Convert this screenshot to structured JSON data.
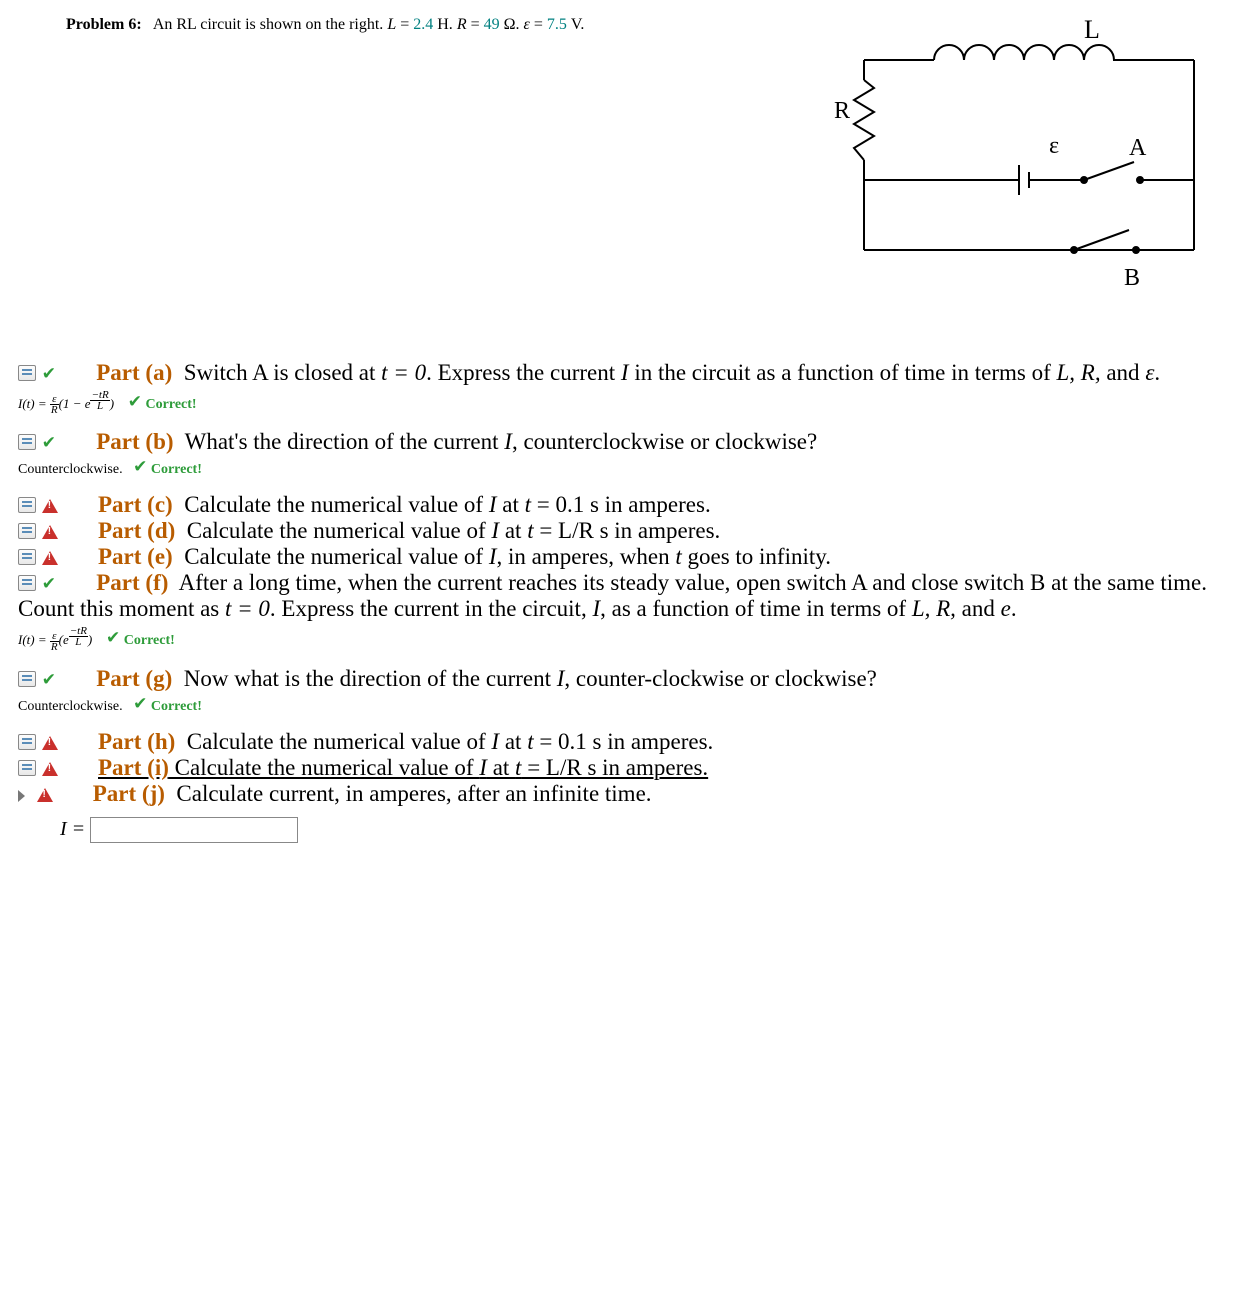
{
  "problem": {
    "label": "Problem 6:",
    "text_pre": "An RL circuit is shown on the right. ",
    "L_sym": "L",
    "L_eq": " = ",
    "L_val": "2.4",
    "L_unit": " H. ",
    "R_sym": "R",
    "R_eq": " = ",
    "R_val": "49",
    "R_unit": " Ω. ",
    "E_sym": "ε",
    "E_eq": " = ",
    "E_val": "7.5",
    "E_unit": " V."
  },
  "circuit": {
    "L": "L",
    "R": "R",
    "eps": "ε",
    "A": "A",
    "B": "B"
  },
  "parts": {
    "a": {
      "label": "Part (a)",
      "text1": "Switch A is closed at ",
      "eq": "t = 0",
      "text2": ". Express the current ",
      "Isym": "I",
      "text3": " in the circuit as a function of time in terms of ",
      "vars": "L, R,",
      "text4": " and ",
      "eps": "ε",
      "period": ".",
      "formula_prefix": "I(t) = ",
      "formula_num": "ε",
      "formula_den": "R",
      "formula_mid": "(1 − e",
      "formula_exp_num": "−tR",
      "formula_exp_den": "L",
      "formula_suffix": ")",
      "correct": "Correct!"
    },
    "b": {
      "label": "Part (b)",
      "text": "What's the direction of the current ",
      "Isym": "I",
      "text2": ", counterclockwise or clockwise?",
      "answer": "Counterclockwise.",
      "correct": "Correct!"
    },
    "c": {
      "label": "Part (c)",
      "text": "Calculate the numerical value of ",
      "I": "I",
      "mid": " at ",
      "t": "t",
      "eq": " = 0.1 s in amperes."
    },
    "d": {
      "label": "Part (d)",
      "text": "Calculate the numerical value of ",
      "I": "I",
      "mid": " at ",
      "t": "t",
      "eq": " = L/R s in amperes."
    },
    "e": {
      "label": "Part (e)",
      "text": "Calculate the numerical value of ",
      "I": "I",
      "mid": ", in amperes, when ",
      "t": "t",
      "eq": " goes to infinity."
    },
    "f": {
      "label": "Part (f)",
      "text1": "After a long time, when the current reaches its steady value, open switch A and close switch B at the same time. Count this moment as ",
      "eq": "t = 0",
      "text2": ". Express the current in the circuit, ",
      "Isym": "I",
      "text3": ", as a function of time in terms of ",
      "vars": "L, R,",
      "text4": " and ",
      "e": "e",
      "period": ".",
      "formula_prefix": "I(t) = ",
      "formula_num": "ε",
      "formula_den": "R",
      "formula_mid": "(e",
      "formula_exp_num": "−tR",
      "formula_exp_den": "L",
      "formula_suffix": ")",
      "correct": "Correct!"
    },
    "g": {
      "label": "Part (g)",
      "text": "Now what is the direction of the current ",
      "Isym": "I",
      "text2": ", counter-clockwise or clockwise?",
      "answer": "Counterclockwise.",
      "correct": "Correct!"
    },
    "h": {
      "label": "Part (h)",
      "text": "Calculate the numerical value of ",
      "I": "I",
      "mid": " at ",
      "t": "t",
      "eq": " = 0.1 s in amperes."
    },
    "i": {
      "label": "Part (i)",
      "text": " Calculate the numerical value of ",
      "I": "I",
      "mid": " at ",
      "t": "t",
      "eq": " = L/R s in amperes. "
    },
    "j": {
      "label": "Part (j)",
      "text": "Calculate current, in amperes, after an infinite time."
    }
  },
  "input": {
    "label": "I = ",
    "value": ""
  }
}
